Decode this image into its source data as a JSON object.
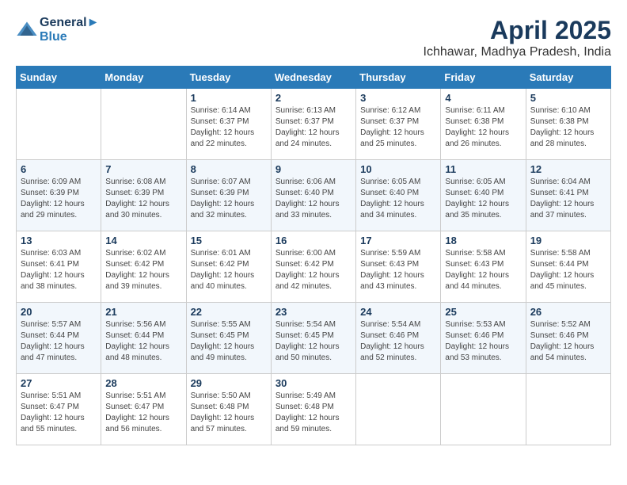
{
  "header": {
    "logo_line1": "General",
    "logo_line2": "Blue",
    "month": "April 2025",
    "location": "Ichhawar, Madhya Pradesh, India"
  },
  "weekdays": [
    "Sunday",
    "Monday",
    "Tuesday",
    "Wednesday",
    "Thursday",
    "Friday",
    "Saturday"
  ],
  "weeks": [
    [
      {
        "day": "",
        "empty": true
      },
      {
        "day": "",
        "empty": true
      },
      {
        "day": "1",
        "sunrise": "Sunrise: 6:14 AM",
        "sunset": "Sunset: 6:37 PM",
        "daylight": "Daylight: 12 hours and 22 minutes."
      },
      {
        "day": "2",
        "sunrise": "Sunrise: 6:13 AM",
        "sunset": "Sunset: 6:37 PM",
        "daylight": "Daylight: 12 hours and 24 minutes."
      },
      {
        "day": "3",
        "sunrise": "Sunrise: 6:12 AM",
        "sunset": "Sunset: 6:37 PM",
        "daylight": "Daylight: 12 hours and 25 minutes."
      },
      {
        "day": "4",
        "sunrise": "Sunrise: 6:11 AM",
        "sunset": "Sunset: 6:38 PM",
        "daylight": "Daylight: 12 hours and 26 minutes."
      },
      {
        "day": "5",
        "sunrise": "Sunrise: 6:10 AM",
        "sunset": "Sunset: 6:38 PM",
        "daylight": "Daylight: 12 hours and 28 minutes."
      }
    ],
    [
      {
        "day": "6",
        "sunrise": "Sunrise: 6:09 AM",
        "sunset": "Sunset: 6:39 PM",
        "daylight": "Daylight: 12 hours and 29 minutes."
      },
      {
        "day": "7",
        "sunrise": "Sunrise: 6:08 AM",
        "sunset": "Sunset: 6:39 PM",
        "daylight": "Daylight: 12 hours and 30 minutes."
      },
      {
        "day": "8",
        "sunrise": "Sunrise: 6:07 AM",
        "sunset": "Sunset: 6:39 PM",
        "daylight": "Daylight: 12 hours and 32 minutes."
      },
      {
        "day": "9",
        "sunrise": "Sunrise: 6:06 AM",
        "sunset": "Sunset: 6:40 PM",
        "daylight": "Daylight: 12 hours and 33 minutes."
      },
      {
        "day": "10",
        "sunrise": "Sunrise: 6:05 AM",
        "sunset": "Sunset: 6:40 PM",
        "daylight": "Daylight: 12 hours and 34 minutes."
      },
      {
        "day": "11",
        "sunrise": "Sunrise: 6:05 AM",
        "sunset": "Sunset: 6:40 PM",
        "daylight": "Daylight: 12 hours and 35 minutes."
      },
      {
        "day": "12",
        "sunrise": "Sunrise: 6:04 AM",
        "sunset": "Sunset: 6:41 PM",
        "daylight": "Daylight: 12 hours and 37 minutes."
      }
    ],
    [
      {
        "day": "13",
        "sunrise": "Sunrise: 6:03 AM",
        "sunset": "Sunset: 6:41 PM",
        "daylight": "Daylight: 12 hours and 38 minutes."
      },
      {
        "day": "14",
        "sunrise": "Sunrise: 6:02 AM",
        "sunset": "Sunset: 6:42 PM",
        "daylight": "Daylight: 12 hours and 39 minutes."
      },
      {
        "day": "15",
        "sunrise": "Sunrise: 6:01 AM",
        "sunset": "Sunset: 6:42 PM",
        "daylight": "Daylight: 12 hours and 40 minutes."
      },
      {
        "day": "16",
        "sunrise": "Sunrise: 6:00 AM",
        "sunset": "Sunset: 6:42 PM",
        "daylight": "Daylight: 12 hours and 42 minutes."
      },
      {
        "day": "17",
        "sunrise": "Sunrise: 5:59 AM",
        "sunset": "Sunset: 6:43 PM",
        "daylight": "Daylight: 12 hours and 43 minutes."
      },
      {
        "day": "18",
        "sunrise": "Sunrise: 5:58 AM",
        "sunset": "Sunset: 6:43 PM",
        "daylight": "Daylight: 12 hours and 44 minutes."
      },
      {
        "day": "19",
        "sunrise": "Sunrise: 5:58 AM",
        "sunset": "Sunset: 6:44 PM",
        "daylight": "Daylight: 12 hours and 45 minutes."
      }
    ],
    [
      {
        "day": "20",
        "sunrise": "Sunrise: 5:57 AM",
        "sunset": "Sunset: 6:44 PM",
        "daylight": "Daylight: 12 hours and 47 minutes."
      },
      {
        "day": "21",
        "sunrise": "Sunrise: 5:56 AM",
        "sunset": "Sunset: 6:44 PM",
        "daylight": "Daylight: 12 hours and 48 minutes."
      },
      {
        "day": "22",
        "sunrise": "Sunrise: 5:55 AM",
        "sunset": "Sunset: 6:45 PM",
        "daylight": "Daylight: 12 hours and 49 minutes."
      },
      {
        "day": "23",
        "sunrise": "Sunrise: 5:54 AM",
        "sunset": "Sunset: 6:45 PM",
        "daylight": "Daylight: 12 hours and 50 minutes."
      },
      {
        "day": "24",
        "sunrise": "Sunrise: 5:54 AM",
        "sunset": "Sunset: 6:46 PM",
        "daylight": "Daylight: 12 hours and 52 minutes."
      },
      {
        "day": "25",
        "sunrise": "Sunrise: 5:53 AM",
        "sunset": "Sunset: 6:46 PM",
        "daylight": "Daylight: 12 hours and 53 minutes."
      },
      {
        "day": "26",
        "sunrise": "Sunrise: 5:52 AM",
        "sunset": "Sunset: 6:46 PM",
        "daylight": "Daylight: 12 hours and 54 minutes."
      }
    ],
    [
      {
        "day": "27",
        "sunrise": "Sunrise: 5:51 AM",
        "sunset": "Sunset: 6:47 PM",
        "daylight": "Daylight: 12 hours and 55 minutes."
      },
      {
        "day": "28",
        "sunrise": "Sunrise: 5:51 AM",
        "sunset": "Sunset: 6:47 PM",
        "daylight": "Daylight: 12 hours and 56 minutes."
      },
      {
        "day": "29",
        "sunrise": "Sunrise: 5:50 AM",
        "sunset": "Sunset: 6:48 PM",
        "daylight": "Daylight: 12 hours and 57 minutes."
      },
      {
        "day": "30",
        "sunrise": "Sunrise: 5:49 AM",
        "sunset": "Sunset: 6:48 PM",
        "daylight": "Daylight: 12 hours and 59 minutes."
      },
      {
        "day": "",
        "empty": true
      },
      {
        "day": "",
        "empty": true
      },
      {
        "day": "",
        "empty": true
      }
    ]
  ]
}
